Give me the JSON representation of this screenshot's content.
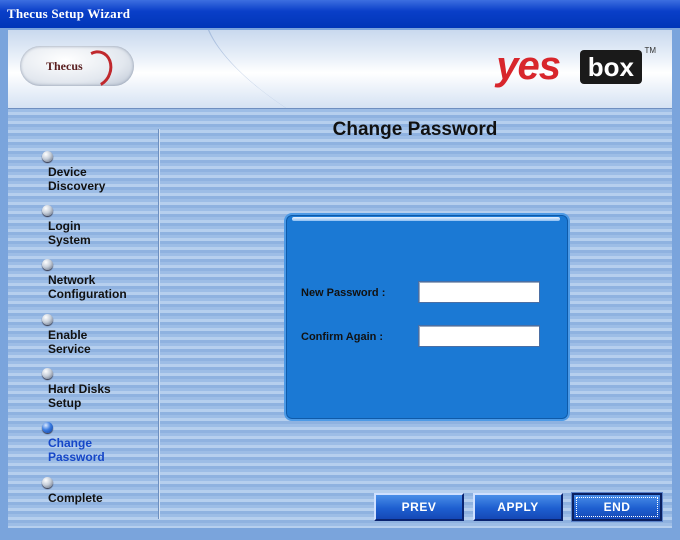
{
  "window": {
    "title": "Thecus Setup Wizard"
  },
  "header": {
    "brand_left": "Thecus",
    "brand_right_yes": "yes",
    "brand_right_box": "box",
    "tm": "TM"
  },
  "sidebar": {
    "items": [
      {
        "label": "Device\nDiscovery",
        "active": false
      },
      {
        "label": "Login\nSystem",
        "active": false
      },
      {
        "label": "Network\nConfiguration",
        "active": false
      },
      {
        "label": "Enable\nService",
        "active": false
      },
      {
        "label": "Hard Disks\nSetup",
        "active": false
      },
      {
        "label": "Change\nPassword",
        "active": true
      },
      {
        "label": "Complete",
        "active": false
      }
    ]
  },
  "main": {
    "title": "Change Password",
    "form": {
      "new_password_label": "New Password :",
      "new_password_value": "",
      "confirm_label": "Confirm Again :",
      "confirm_value": ""
    }
  },
  "buttons": {
    "prev": "PREV",
    "apply": "APPLY",
    "end": "END"
  },
  "colors": {
    "title_bar": "#0a3fc8",
    "panel": "#1b79d4",
    "active_nav": "#1546c8",
    "brand_red": "#d8262c"
  }
}
